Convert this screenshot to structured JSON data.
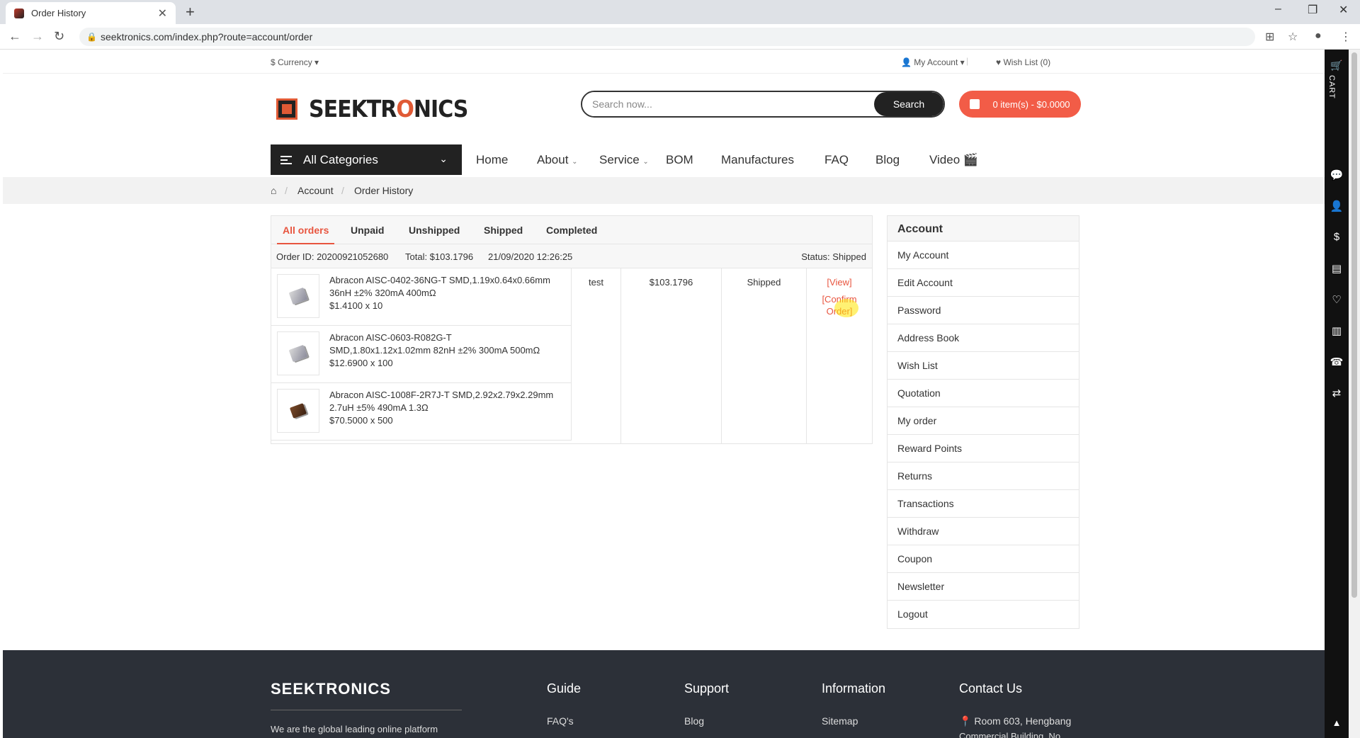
{
  "browser": {
    "tab_title": "Order History",
    "tab_close": "✕",
    "new_tab": "+",
    "url": "seektronics.com/index.php?route=account/order",
    "window_controls": [
      "–",
      "❐",
      "✕"
    ]
  },
  "topbar": {
    "currency": "$ Currency ▾",
    "my_account": "👤 My Account ▾",
    "separator": "|",
    "wish_list": "♥ Wish List (0)"
  },
  "logo": {
    "prefix": "SEEKTR",
    "o": "O",
    "suffix": "NICS"
  },
  "search": {
    "placeholder": "Search now...",
    "button": "Search"
  },
  "cart": {
    "label": "0 item(s) - $0.0000"
  },
  "menu": {
    "all_categories": "All Categories",
    "items": [
      "Home",
      "About",
      "Service",
      "BOM",
      "Manufactures",
      "FAQ",
      "Blog",
      "Video"
    ]
  },
  "breadcrumb": {
    "home_icon": "⌂",
    "items": [
      "Account",
      "Order History"
    ],
    "sep": "/"
  },
  "order_tabs": [
    "All orders",
    "Unpaid",
    "Unshipped",
    "Shipped",
    "Completed"
  ],
  "order": {
    "id": "Order ID: 20200921052680",
    "total": "Total: $103.1796",
    "date": "21/09/2020 12:26:25",
    "status": "Status: Shipped",
    "customer": "test",
    "amount": "$103.1796",
    "state": "Shipped",
    "view_link": "[View]",
    "confirm_link_1": "[Confirm",
    "confirm_link_2": "Order]",
    "items": [
      {
        "line1": "Abracon AISC-0402-36NG-T SMD,1.19x0.64x0.66mm",
        "line2": "36nH ±2% 320mA 400mΩ",
        "price": "$1.4100 x 10"
      },
      {
        "line1": "Abracon AISC-0603-R082G-T",
        "line2": "SMD,1.80x1.12x1.02mm 82nH ±2% 300mA 500mΩ",
        "price": "$12.6900 x 100"
      },
      {
        "line1": "Abracon AISC-1008F-2R7J-T SMD,2.92x2.79x2.29mm",
        "line2": "2.7uH ±5% 490mA 1.3Ω",
        "price": "$70.5000 x 500"
      }
    ]
  },
  "sidebar": {
    "title": "Account",
    "items": [
      "My Account",
      "Edit Account",
      "Password",
      "Address Book",
      "Wish List",
      "Quotation",
      "My order",
      "Reward Points",
      "Returns",
      "Transactions",
      "Withdraw",
      "Coupon",
      "Newsletter",
      "Logout"
    ]
  },
  "right_toolbar": {
    "cart_label": "CART",
    "up": "▲"
  },
  "footer": {
    "brand": "SEEKTRONICS",
    "tagline": "We are the global leading online platform",
    "columns": [
      {
        "title": "Guide",
        "link": "FAQ's"
      },
      {
        "title": "Support",
        "link": "Blog"
      },
      {
        "title": "Information",
        "link": "Sitemap"
      },
      {
        "title": "Contact Us",
        "link": "Room 603, Hengbang"
      }
    ],
    "address_line2": "Commercial Building, No."
  }
}
